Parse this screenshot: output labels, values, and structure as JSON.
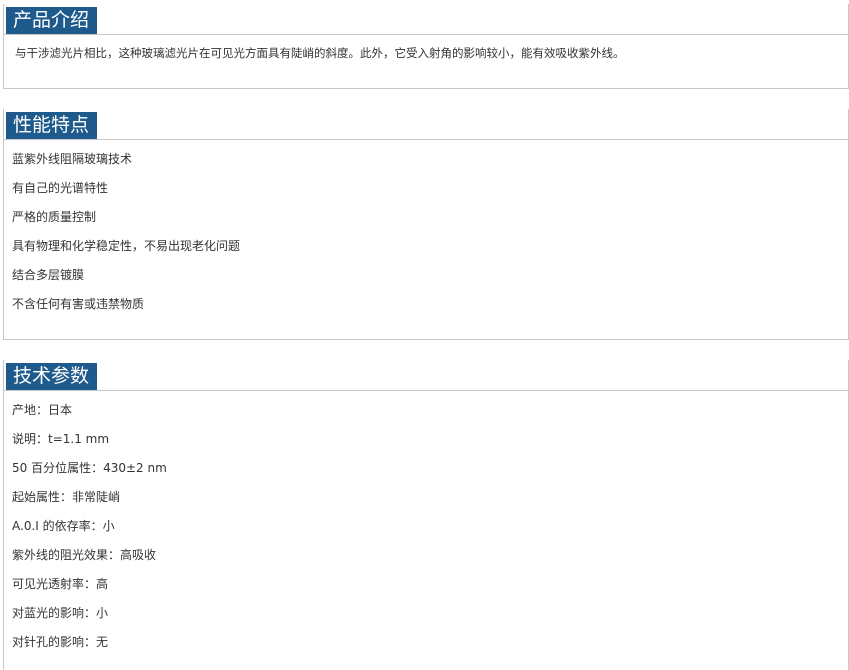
{
  "intro": {
    "title": "产品介绍",
    "text": "与干涉滤光片相比，这种玻璃滤光片在可见光方面具有陡峭的斜度。此外，它受入射角的影响较小，能有效吸收紫外线。"
  },
  "features": {
    "title": "性能特点",
    "items": [
      "蓝紫外线阻隔玻璃技术",
      "有自己的光谱特性",
      "严格的质量控制",
      "具有物理和化学稳定性，不易出现老化问题",
      "结合多层镀膜",
      "不含任何有害或违禁物质"
    ]
  },
  "specs": {
    "title": "技术参数",
    "items": [
      "产地：日本",
      "说明：t=1.1 mm",
      "50 百分位属性：430±2 nm",
      "起始属性：非常陡峭",
      "A.0.I 的依存率：小",
      "紫外线的阻光效果：高吸收",
      "可见光透射率：高",
      "对蓝光的影响：小",
      "对针孔的影响：无"
    ]
  }
}
